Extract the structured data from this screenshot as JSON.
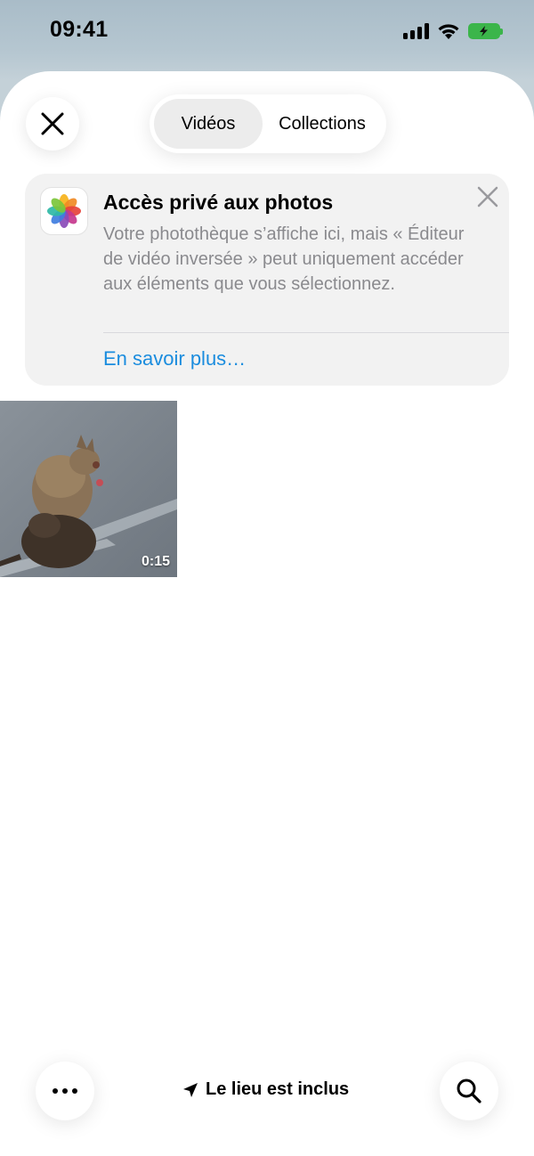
{
  "status_bar": {
    "time": "09:41",
    "battery_color": "#3bb54a"
  },
  "header": {
    "close_icon": "close-icon",
    "tabs": [
      {
        "label": "Vidéos",
        "selected": true
      },
      {
        "label": "Collections",
        "selected": false
      }
    ]
  },
  "banner": {
    "app_icon": "photos-app-icon",
    "title": "Accès privé aux photos",
    "body": "Votre photothèque s’affiche ici, mais « Éditeur de vidéo inversée » peut uniquement accéder aux éléments que vous sélectionnez.",
    "link": "En savoir plus…",
    "link_color": "#1a8cde"
  },
  "media": {
    "items": [
      {
        "type": "video",
        "duration": "0:15",
        "subject": "quokka-photo"
      }
    ]
  },
  "bottom_bar": {
    "more_icon": "more-icon",
    "location_icon": "location-arrow-icon",
    "location_label": "Le lieu est inclus",
    "search_icon": "search-icon"
  }
}
